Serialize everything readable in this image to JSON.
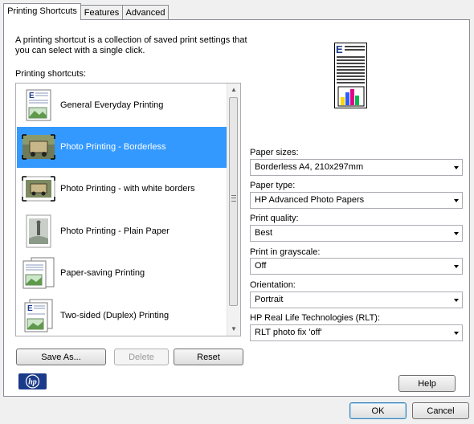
{
  "tabs": [
    {
      "label": "Printing Shortcuts"
    },
    {
      "label": "Features"
    },
    {
      "label": "Advanced"
    }
  ],
  "description": "A printing shortcut is a collection of saved print settings that you can select with a single click.",
  "shortcuts_label": "Printing shortcuts:",
  "shortcuts": [
    {
      "label": "General Everyday Printing",
      "icon": "document-icon"
    },
    {
      "label": "Photo Printing - Borderless",
      "icon": "photo-borderless-icon"
    },
    {
      "label": "Photo Printing - with white borders",
      "icon": "photo-white-borders-icon"
    },
    {
      "label": "Photo Printing - Plain Paper",
      "icon": "photo-plain-paper-icon"
    },
    {
      "label": "Paper-saving Printing",
      "icon": "paper-saving-icon"
    },
    {
      "label": "Two-sided (Duplex) Printing",
      "icon": "duplex-icon"
    }
  ],
  "selected_shortcut": "Photo Printing - Borderless",
  "buttons": {
    "save_as": "Save As...",
    "delete": "Delete",
    "reset": "Reset",
    "help": "Help",
    "ok": "OK",
    "cancel": "Cancel"
  },
  "settings": {
    "paper_sizes": {
      "label": "Paper sizes:",
      "value": "Borderless A4, 210x297mm"
    },
    "paper_type": {
      "label": "Paper type:",
      "value": "HP Advanced Photo Papers"
    },
    "print_quality": {
      "label": "Print quality:",
      "value": "Best"
    },
    "grayscale": {
      "label": "Print in grayscale:",
      "value": "Off"
    },
    "orientation": {
      "label": "Orientation:",
      "value": "Portrait"
    },
    "rlt": {
      "label": "HP Real Life Technologies (RLT):",
      "value": "RLT photo fix 'off'"
    }
  },
  "logo_text": "hp",
  "colors": {
    "selection": "#3399ff",
    "hp_blue": "#1a3a8a"
  }
}
